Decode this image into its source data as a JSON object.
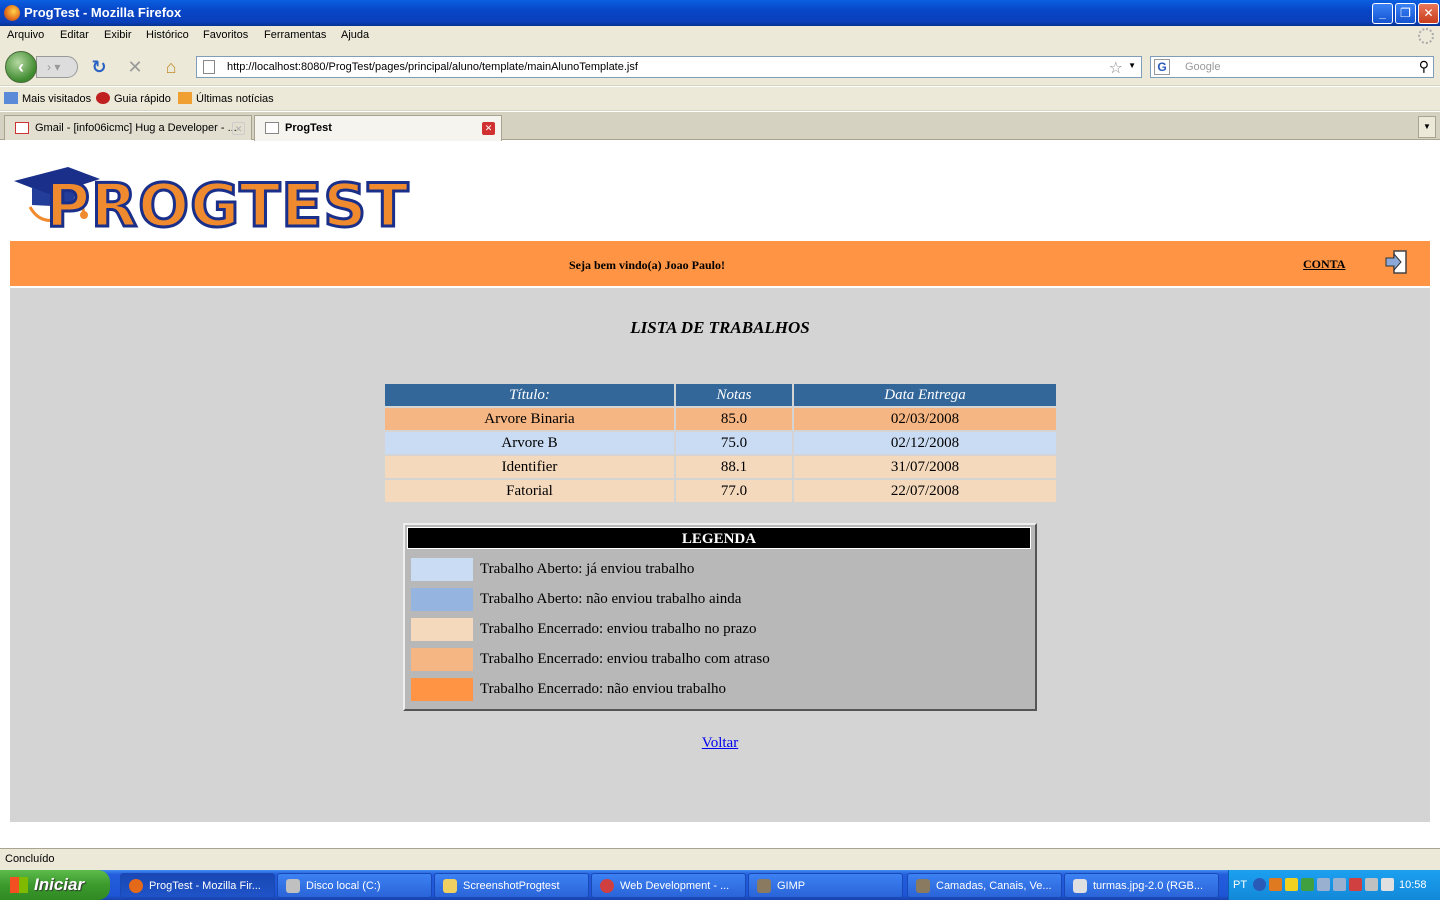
{
  "window": {
    "title": "ProgTest - Mozilla Firefox",
    "min_label": "_",
    "max_label": "❐",
    "close_label": "✕"
  },
  "menu": [
    "Arquivo",
    "Editar",
    "Exibir",
    "Histórico",
    "Favoritos",
    "Ferramentas",
    "Ajuda"
  ],
  "nav": {
    "url": "http://localhost:8080/ProgTest/pages/principal/aluno/template/mainAlunoTemplate.jsf",
    "search_placeholder": "Google"
  },
  "bookmarks": [
    "Mais visitados",
    "Guia rápido",
    "Últimas notícias"
  ],
  "tabs": [
    {
      "label": "Gmail - [info06icmc] Hug a Developer - ...",
      "active": false
    },
    {
      "label": "ProgTest",
      "active": true
    }
  ],
  "page": {
    "logo_text": "PROGTEST",
    "welcome": "Seja bem vindo(a) Joao Paulo!",
    "account_link": "CONTA",
    "title": "LISTA DE TRABALHOS",
    "table": {
      "headers": [
        "Título:",
        "Notas",
        "Data Entrega"
      ],
      "rows": [
        {
          "titulo": "Arvore Binaria",
          "nota": "85.0",
          "data": "02/03/2008",
          "color": "#f6b683"
        },
        {
          "titulo": "Arvore B",
          "nota": "75.0",
          "data": "02/12/2008",
          "color": "#cadcf4"
        },
        {
          "titulo": "Identifier",
          "nota": "88.1",
          "data": "31/07/2008",
          "color": "#f5d9bd"
        },
        {
          "titulo": "Fatorial",
          "nota": "77.0",
          "data": "22/07/2008",
          "color": "#f5d9bd"
        }
      ]
    },
    "legend": {
      "title": "LEGENDA",
      "items": [
        {
          "label": "Trabalho Aberto: já enviou trabalho",
          "color": "#cadcf4"
        },
        {
          "label": "Trabalho Aberto: não enviou trabalho ainda",
          "color": "#95b4e0"
        },
        {
          "label": "Trabalho Encerrado: enviou trabalho no prazo",
          "color": "#f5d9bd"
        },
        {
          "label": "Trabalho Encerrado: enviou trabalho com atraso",
          "color": "#f6b683"
        },
        {
          "label": "Trabalho Encerrado: não enviou trabalho",
          "color": "#fe9444"
        }
      ]
    },
    "back_link": "Voltar"
  },
  "status": "Concluído",
  "taskbar": {
    "start": "Iniciar",
    "tasks": [
      {
        "label": "ProgTest - Mozilla Fir...",
        "active": true
      },
      {
        "label": "Disco local (C:)",
        "active": false
      },
      {
        "label": "ScreenshotProgtest",
        "active": false
      },
      {
        "label": "Web Development - ...",
        "active": false
      },
      {
        "label": "GIMP",
        "active": false
      },
      {
        "label": "Camadas, Canais, Ve...",
        "active": false
      },
      {
        "label": "turmas.jpg-2.0 (RGB...",
        "active": false
      }
    ],
    "lang": "PT",
    "clock": "10:58"
  },
  "colors": {
    "orange_bar": "#fe9444",
    "header_blue": "#336699",
    "content_gray": "#d4d4d4"
  }
}
